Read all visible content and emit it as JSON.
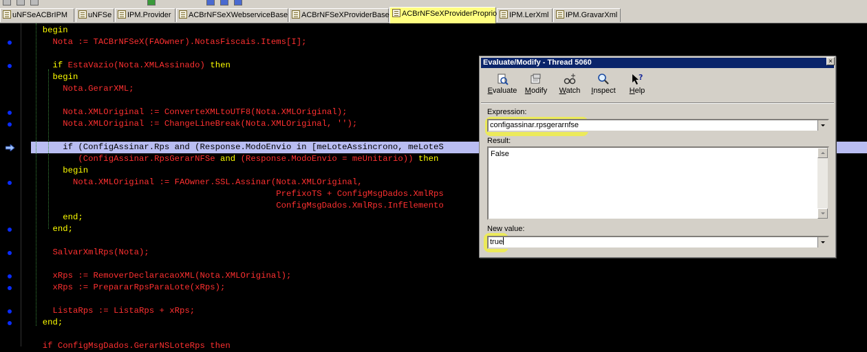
{
  "tabs": [
    {
      "label": "uNFSeACBrIPM",
      "active": false
    },
    {
      "label": "uNFSe",
      "active": false
    },
    {
      "label": "IPM.Provider",
      "active": false
    },
    {
      "label": "ACBrNFSeXWebserviceBase",
      "active": false
    },
    {
      "label": "ACBrNFSeXProviderBase",
      "active": false
    },
    {
      "label": "ACBrNFSeXProviderProprio",
      "active": true
    },
    {
      "label": "IPM.LerXml",
      "active": false
    },
    {
      "label": "IPM.GravarXml",
      "active": false
    }
  ],
  "code": {
    "lines": [
      {
        "segments": [
          {
            "t": "  "
          },
          {
            "t": "begin",
            "c": "kw"
          }
        ]
      },
      {
        "segments": [
          {
            "t": "    Nota := TACBrNFSeX(FAOwner).NotasFiscais.Items[I];"
          }
        ]
      },
      {
        "segments": [
          {
            "t": ""
          }
        ]
      },
      {
        "segments": [
          {
            "t": "    "
          },
          {
            "t": "if",
            "c": "kw"
          },
          {
            "t": " EstaVazio(Nota.XMLAssinado) "
          },
          {
            "t": "then",
            "c": "kw"
          }
        ]
      },
      {
        "segments": [
          {
            "t": "    "
          },
          {
            "t": "begin",
            "c": "kw"
          }
        ]
      },
      {
        "segments": [
          {
            "t": "      Nota.GerarXML;"
          }
        ]
      },
      {
        "segments": [
          {
            "t": ""
          }
        ]
      },
      {
        "segments": [
          {
            "t": "      Nota.XMLOriginal := ConverteXMLtoUTF8(Nota.XMLOriginal);"
          }
        ]
      },
      {
        "segments": [
          {
            "t": "      Nota.XMLOriginal := ChangeLineBreak(Nota.XMLOriginal, '');"
          }
        ]
      },
      {
        "segments": [
          {
            "t": ""
          }
        ]
      },
      {
        "segments": [
          {
            "t": "      if (ConfigAssinar.Rps and (Response.ModoEnvio in [meLoteAssincrono, meLoteS"
          }
        ],
        "hl": true
      },
      {
        "segments": [
          {
            "t": "         (ConfigAssinar.RpsGerarNFSe "
          },
          {
            "t": "and",
            "c": "kw"
          },
          {
            "t": " (Response.ModoEnvio = meUnitario)) "
          },
          {
            "t": "then",
            "c": "kw"
          }
        ]
      },
      {
        "segments": [
          {
            "t": "      "
          },
          {
            "t": "begin",
            "c": "kw"
          }
        ]
      },
      {
        "segments": [
          {
            "t": "        Nota.XMLOriginal := FAOwner.SSL.Assinar(Nota.XMLOriginal,"
          }
        ]
      },
      {
        "segments": [
          {
            "t": "                                                PrefixoTS + ConfigMsgDados.XmlRps"
          }
        ]
      },
      {
        "segments": [
          {
            "t": "                                                ConfigMsgDados.XmlRps.InfElemento"
          }
        ]
      },
      {
        "segments": [
          {
            "t": "      "
          },
          {
            "t": "end;",
            "c": "kw"
          }
        ]
      },
      {
        "segments": [
          {
            "t": "    "
          },
          {
            "t": "end;",
            "c": "kw"
          }
        ]
      },
      {
        "segments": [
          {
            "t": ""
          }
        ]
      },
      {
        "segments": [
          {
            "t": "    SalvarXmlRps(Nota);"
          }
        ]
      },
      {
        "segments": [
          {
            "t": ""
          }
        ]
      },
      {
        "segments": [
          {
            "t": "    xRps := RemoverDeclaracaoXML(Nota.XMLOriginal);"
          }
        ]
      },
      {
        "segments": [
          {
            "t": "    xRps := PrepararRpsParaLote(xRps);"
          }
        ]
      },
      {
        "segments": [
          {
            "t": ""
          }
        ]
      },
      {
        "segments": [
          {
            "t": "    ListaRps := ListaRps + xRps;"
          }
        ]
      },
      {
        "segments": [
          {
            "t": "  "
          },
          {
            "t": "end;",
            "c": "kw"
          }
        ]
      },
      {
        "segments": [
          {
            "t": ""
          }
        ]
      },
      {
        "segments": [
          {
            "t": "  if ConfigMsgDados.GerarNSLoteRps then"
          }
        ]
      }
    ]
  },
  "dialog": {
    "title": "Evaluate/Modify - Thread 5060",
    "close": "×",
    "toolbar": [
      {
        "pre": "",
        "u": "E",
        "post": "valuate",
        "icon": "evaluate-icon"
      },
      {
        "pre": "",
        "u": "M",
        "post": "odify",
        "icon": "modify-icon"
      },
      {
        "pre": "",
        "u": "W",
        "post": "atch",
        "icon": "watch-icon"
      },
      {
        "pre": "",
        "u": "I",
        "post": "nspect",
        "icon": "inspect-icon"
      },
      {
        "pre": "",
        "u": "H",
        "post": "elp",
        "icon": "help-icon"
      }
    ],
    "expression_label": "Expression:",
    "expression_value": "configassinar.rpsgerarnfse",
    "result_label": "Result:",
    "result_value": "False",
    "new_value_label": "New value:",
    "new_value": "true"
  }
}
